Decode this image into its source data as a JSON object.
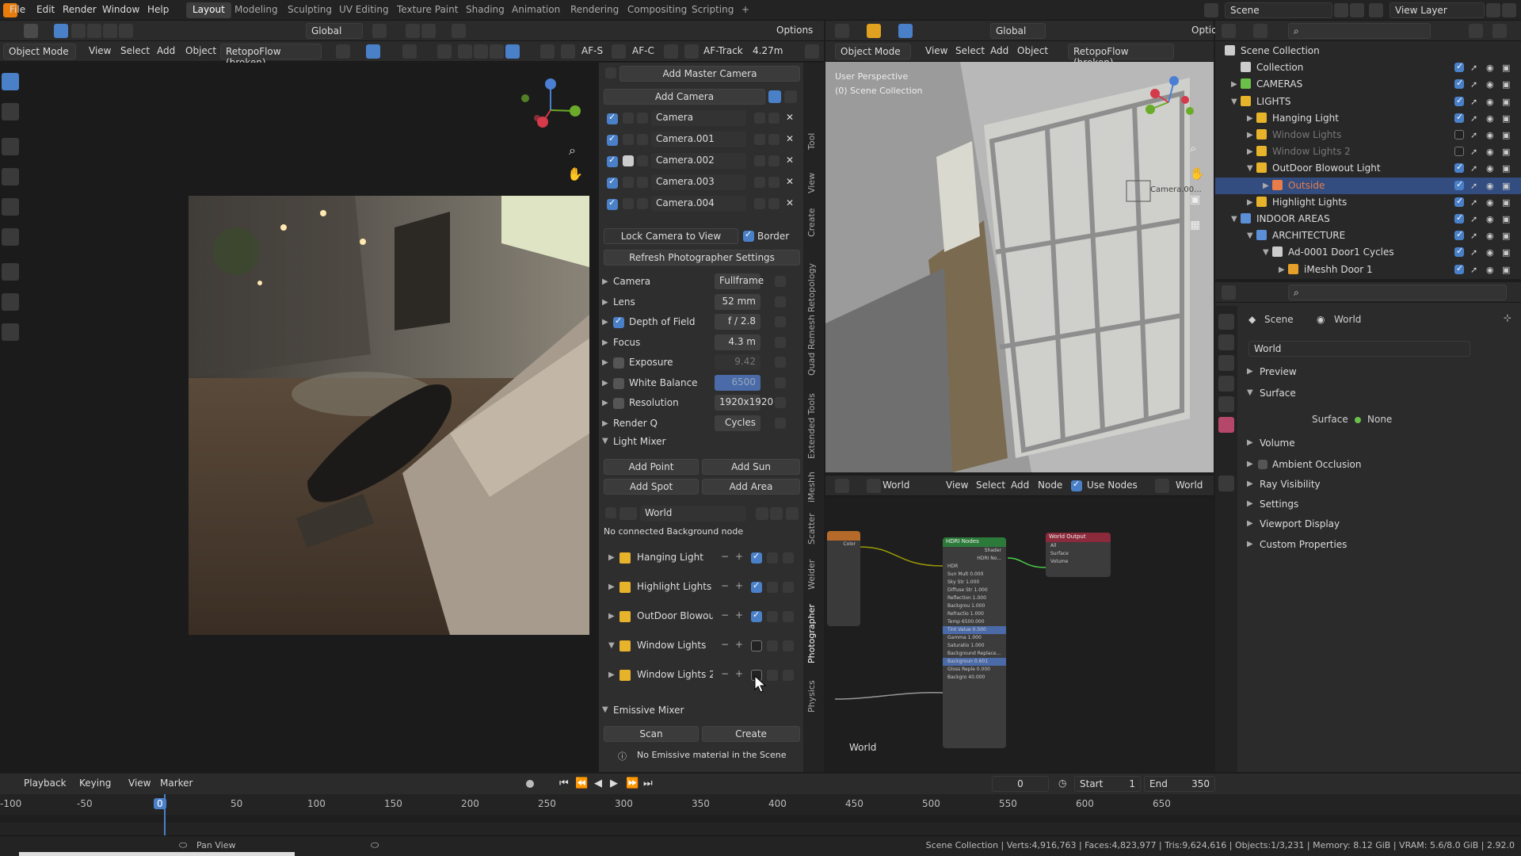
{
  "menu": [
    "File",
    "Edit",
    "Render",
    "Window",
    "Help"
  ],
  "workspaces": [
    "Layout",
    "Modeling",
    "Sculpting",
    "UV Editing",
    "Texture Paint",
    "Shading",
    "Animation",
    "Rendering",
    "Compositing",
    "Scripting",
    "+"
  ],
  "active_workspace": "Layout",
  "top_right": {
    "scene": "Scene",
    "view_layer": "View Layer"
  },
  "viewport_header": {
    "transform_orientation": "Global",
    "options": "Options",
    "mode": "Object Mode",
    "menus": [
      "View",
      "Select",
      "Add",
      "Object"
    ],
    "addon": "RetopoFlow (broken)",
    "af_s": "AF-S",
    "af_c": "AF-C",
    "af_track": "AF-Track",
    "distance": "4.27m"
  },
  "photographer_panel": {
    "add_master_camera": "Add Master Camera",
    "add_camera": "Add Camera",
    "cameras": [
      "Camera",
      "Camera.001",
      "Camera.002",
      "Camera.003",
      "Camera.004"
    ],
    "lock_camera": "Lock Camera to View",
    "border": "Border",
    "refresh": "Refresh Photographer Settings",
    "settings": [
      {
        "label": "Camera",
        "value": "Fullframe"
      },
      {
        "label": "Lens",
        "value": "52 mm"
      },
      {
        "label": "Depth of Field",
        "value": "f / 2.8"
      },
      {
        "label": "Focus",
        "value": "4.3 m"
      },
      {
        "label": "Exposure",
        "value": "9.42"
      },
      {
        "label": "White Balance",
        "value": "6500"
      },
      {
        "label": "Resolution",
        "value": "1920x1920"
      },
      {
        "label": "Render Q",
        "value": "Cycles"
      }
    ],
    "light_mixer": "Light Mixer",
    "add_point": "Add Point",
    "add_sun": "Add Sun",
    "add_spot": "Add Spot",
    "add_area": "Add Area",
    "world": "World",
    "no_bg_node": "No connected Background node",
    "light_groups": [
      "Hanging Light",
      "Highlight Lights",
      "OutDoor Blowout ...",
      "Window Lights",
      "Window Lights 2"
    ],
    "emissive_mixer": "Emissive Mixer",
    "scan": "Scan",
    "create": "Create",
    "no_emissive": "No Emissive material in the Scene"
  },
  "vertical_tabs": [
    "Tool",
    "View",
    "Create",
    "Retopology",
    "Quad Remesh",
    "Extended Tools",
    "iMeshh",
    "Scatter",
    "Weider",
    "Photographer",
    "Physics"
  ],
  "right_viewport": {
    "mode": "Object Mode",
    "menus": [
      "View",
      "Select",
      "Add",
      "Object"
    ],
    "addon": "RetopoFlow (broken)",
    "orientation": "Global",
    "options": "Option",
    "perspective": "User Perspective",
    "collection": "(0) Scene Collection",
    "camera_label": "Camera.00..."
  },
  "node_editor": {
    "world": "World",
    "menus": [
      "View",
      "Select",
      "Add",
      "Node"
    ],
    "use_nodes": "Use Nodes",
    "world_right": "World",
    "footer": "World",
    "nodes": {
      "color": {
        "title": "",
        "rows": [
          "Color"
        ]
      },
      "hdr": {
        "title": "HDRI Nodes",
        "rows": [
          "Shader",
          "HDRI No...",
          "HDR",
          "Sun Mult 0.000",
          "Sky Str 1.000",
          "Diffuse Str 1.000",
          "Reflection 1.000",
          "Backgrou 1.000",
          "Refractio 1.000",
          "Temp 6500.000",
          "Tint Value 0.500",
          "Gamma 1.000",
          "Saturatio 1.000",
          "Background Replace...",
          "Backgroun 0.601",
          "Gloss Reple 0.000",
          "Backgro 40.000"
        ]
      },
      "output": {
        "title": "World Output",
        "rows": [
          "All",
          "Surface",
          "Volume"
        ]
      }
    }
  },
  "outliner": {
    "rows": [
      {
        "label": "Scene Collection",
        "indent": 0,
        "icon": "collection"
      },
      {
        "label": "Collection",
        "indent": 1,
        "icon": "collection"
      },
      {
        "label": "CAMERAS",
        "indent": 1,
        "icon": "collection-green"
      },
      {
        "label": "LIGHTS",
        "indent": 1,
        "icon": "collection-yellow"
      },
      {
        "label": "Hanging Light",
        "indent": 2,
        "icon": "collection-yellow"
      },
      {
        "label": "Window Lights",
        "indent": 2,
        "icon": "collection-yellow",
        "dim": true
      },
      {
        "label": "Window Lights 2",
        "indent": 2,
        "icon": "collection-yellow",
        "dim": true
      },
      {
        "label": "OutDoor Blowout Light",
        "indent": 2,
        "icon": "collection-yellow"
      },
      {
        "label": "Outside",
        "indent": 3,
        "icon": "light",
        "selected": true
      },
      {
        "label": "Highlight Lights",
        "indent": 2,
        "icon": "collection-yellow"
      },
      {
        "label": "INDOOR AREAS",
        "indent": 1,
        "icon": "collection-blue"
      },
      {
        "label": "ARCHITECTURE",
        "indent": 2,
        "icon": "collection-blue"
      },
      {
        "label": "Ad-0001 Door1 Cycles",
        "indent": 3,
        "icon": "collection"
      },
      {
        "label": "iMeshh Door 1",
        "indent": 4,
        "icon": "mesh"
      }
    ]
  },
  "properties": {
    "breadcrumb_scene": "Scene",
    "breadcrumb_world": "World",
    "world_name": "World",
    "sections": [
      "Preview",
      "Surface",
      "Volume",
      "Ambient Occlusion",
      "Ray Visibility",
      "Settings",
      "Viewport Display",
      "Custom Properties"
    ],
    "surface_label": "Surface",
    "surface_value": "None"
  },
  "timeline": {
    "menus": [
      "Playback",
      "Keying",
      "View",
      "Marker"
    ],
    "current_frame": "0",
    "start_label": "Start",
    "start": "1",
    "end_label": "End",
    "end": "350",
    "ticks": [
      "-100",
      "-50",
      "0",
      "50",
      "100",
      "150",
      "200",
      "250",
      "300",
      "350",
      "400",
      "450",
      "500",
      "550",
      "600",
      "650"
    ]
  },
  "status": {
    "left": "Pan View",
    "stats": "Scene Collection | Verts:4,916,763 | Faces:4,823,977 | Tris:9,624,616 | Objects:1/3,231 | Memory: 8.12 GiB | VRAM: 5.6/8.0 GiB | 2.92.0"
  },
  "colors": {
    "accent": "#4a80c8",
    "selected_row": "#334d80",
    "collection_yellow": "#e6b32a",
    "frame_marker": "#4a80c8"
  }
}
